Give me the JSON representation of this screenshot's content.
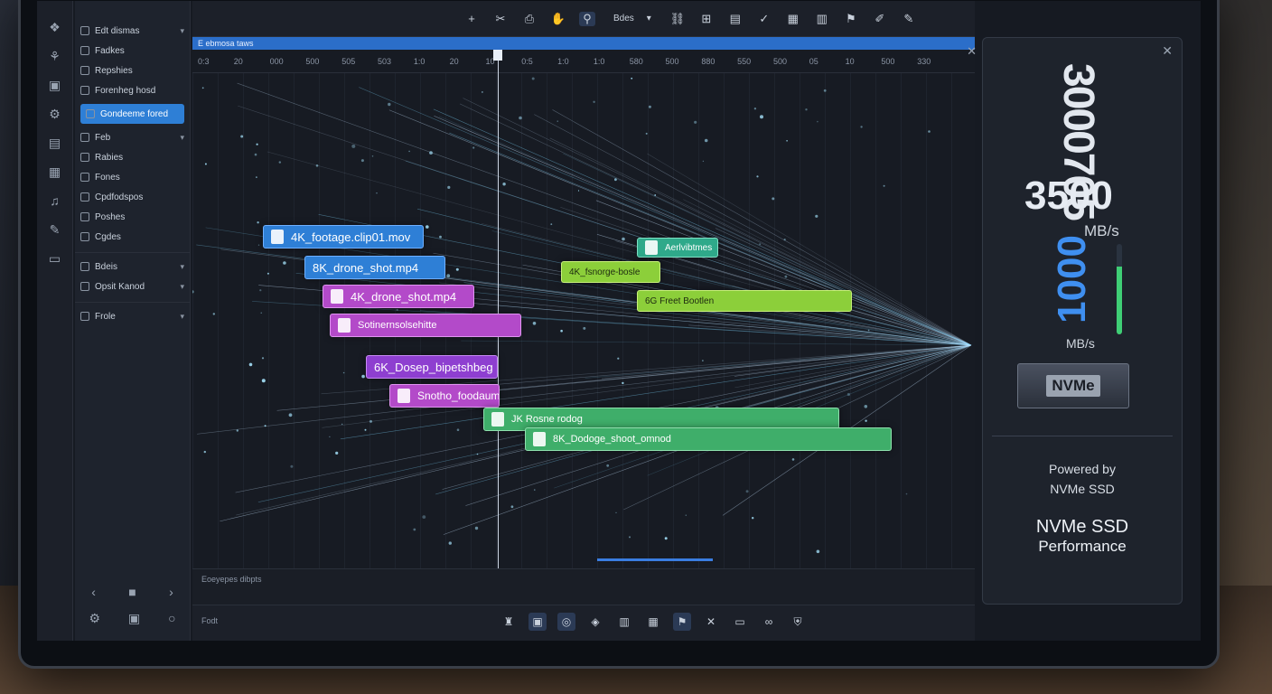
{
  "toolbar": {
    "view_select_label": "Bdes",
    "buttons": [
      "plus-icon",
      "cut-icon",
      "stamp-icon",
      "hand-icon",
      "pin-icon",
      "link-icon",
      "grid-icon",
      "save-icon",
      "check-icon",
      "film-icon",
      "doc-icon",
      "flag-icon",
      "pen-icon",
      "pencil-icon"
    ]
  },
  "sidebar": {
    "items": [
      {
        "label": "Edt dismas",
        "chev": true
      },
      {
        "label": "Fadkes",
        "chev": false
      },
      {
        "label": "Repshies",
        "chev": false
      },
      {
        "label": "Forenheg hosd",
        "chev": false
      },
      {
        "label": "Gondeeme fored",
        "active": true
      },
      {
        "label": "Feb",
        "chev": true
      },
      {
        "label": "Rabies",
        "chev": false
      },
      {
        "label": "Fones",
        "chev": false
      },
      {
        "label": "Cpdfodspos",
        "chev": false
      },
      {
        "label": "Poshes",
        "chev": false
      },
      {
        "label": "Cgdes",
        "chev": false
      },
      {
        "label": "Bdeis",
        "chev": true
      },
      {
        "label": "Opsit Kanod",
        "chev": true
      },
      {
        "label": "Frole",
        "chev": true
      }
    ]
  },
  "timeline": {
    "header_label": "E ebmosa taws",
    "ticks": [
      "0:3",
      "20",
      "000",
      "500",
      "505",
      "503",
      "1:0",
      "20",
      "10",
      "0:5",
      "1:0",
      "1:0",
      "580",
      "500",
      "880",
      "550",
      "500",
      "05",
      "10",
      "500",
      "330"
    ],
    "playhead_fraction": 0.39,
    "clips": [
      {
        "label": "4K_footage.clip01.mov",
        "color": "blue"
      },
      {
        "label": "8K_drone_shot.mp4",
        "color": "blue"
      },
      {
        "label": "4K_drone_shot.mp4",
        "color": "magenta"
      },
      {
        "label": "Sotinernsolsehitte",
        "color": "magenta"
      },
      {
        "label": "6K_Dosep_bipetshbeg",
        "color": "purple"
      },
      {
        "label": "Snotho_foodaum",
        "color": "magenta"
      },
      {
        "label": "JK Rosne rodog",
        "color": "green"
      },
      {
        "label": "8K_Dodoge_shoot_omnod",
        "color": "green"
      },
      {
        "label": "Aerlvibtmes",
        "color": "teal"
      },
      {
        "label": "4K_fsnorge-bosle",
        "color": "lime"
      },
      {
        "label": "6G Freet Bootlen",
        "color": "lime"
      }
    ]
  },
  "bottom": {
    "label": "Eoeyepes dibpts",
    "footer_label": "Fodt"
  },
  "perf": {
    "vertical_number": "3000705",
    "read_speed": "3500",
    "read_unit": "MB/s",
    "write_speed": "1000",
    "write_unit": "MB/s",
    "meter_level": 0.75,
    "ssd_label": "NVMe",
    "powered_line1": "Powered by",
    "powered_line2": "NVMe SSD",
    "perf_line1": "NVMe SSD",
    "perf_line2": "Performance"
  },
  "colors": {
    "accent": "#2e7fd6",
    "meter": "#3fce75",
    "write_speed": "#3f8ff0"
  }
}
